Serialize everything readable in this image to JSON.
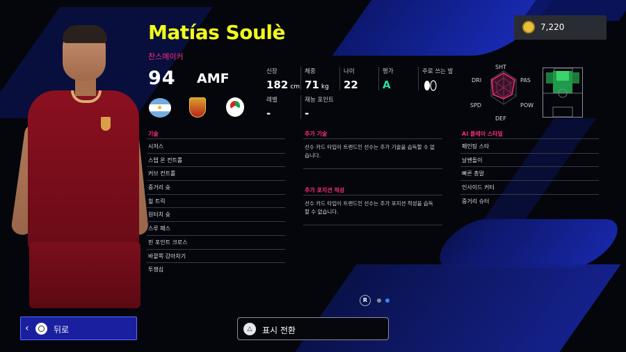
{
  "player": {
    "name": "Matías Soulè",
    "card_type": "찬스메이커",
    "rating": "94",
    "position": "AMF"
  },
  "currency": {
    "amount": "7,220"
  },
  "stats": {
    "height": {
      "label": "신장",
      "value": "182",
      "unit": "cm"
    },
    "weight": {
      "label": "체중",
      "value": "71",
      "unit": "kg"
    },
    "age": {
      "label": "나이",
      "value": "22"
    },
    "grade": {
      "label": "평가",
      "value": "A"
    },
    "foot": {
      "label": "주로 쓰는 발"
    },
    "level": {
      "label": "레벨",
      "value": "-"
    },
    "talent": {
      "label": "재능 포인트",
      "value": "-"
    }
  },
  "radar": {
    "labels": [
      "SHT",
      "PAS",
      "POW",
      "DEF",
      "SPD",
      "DRI"
    ]
  },
  "skills": {
    "title": "기술",
    "items": [
      "시저스",
      "스텝 온 컨트롤",
      "커브 컨트롤",
      "중거리 슛",
      "힐 트릭",
      "원터치 슛",
      "스루 패스",
      "핀 포인트 크로스",
      "바깥쪽 감아차기",
      "투쟁심"
    ]
  },
  "extra_skills": {
    "title": "추가 기술",
    "text": "선수 카드 타입이 트렌드인 선수는 추가 기술을 습득할 수 없습니다."
  },
  "extra_positions": {
    "title": "추가 포지션 적성",
    "text": "선수 카드 타입이 트렌드인 선수는 추가 포지션 적성을 습득할 수 없습니다."
  },
  "ai_styles": {
    "title": "AI 플레이 스타일",
    "items": [
      "페인팅 스타",
      "날쌘돌이",
      "빠른 총알",
      "인사이드 커터",
      "중거리 슈터"
    ]
  },
  "pager": {
    "r_label": "R"
  },
  "buttons": {
    "back": "뒤로",
    "switch_view": "표시 전환"
  },
  "colors": {
    "name": "#f2ff1a",
    "accent": "#ff2d7a",
    "grade": "#22e0a0",
    "back_button": "#1a1fa0"
  }
}
